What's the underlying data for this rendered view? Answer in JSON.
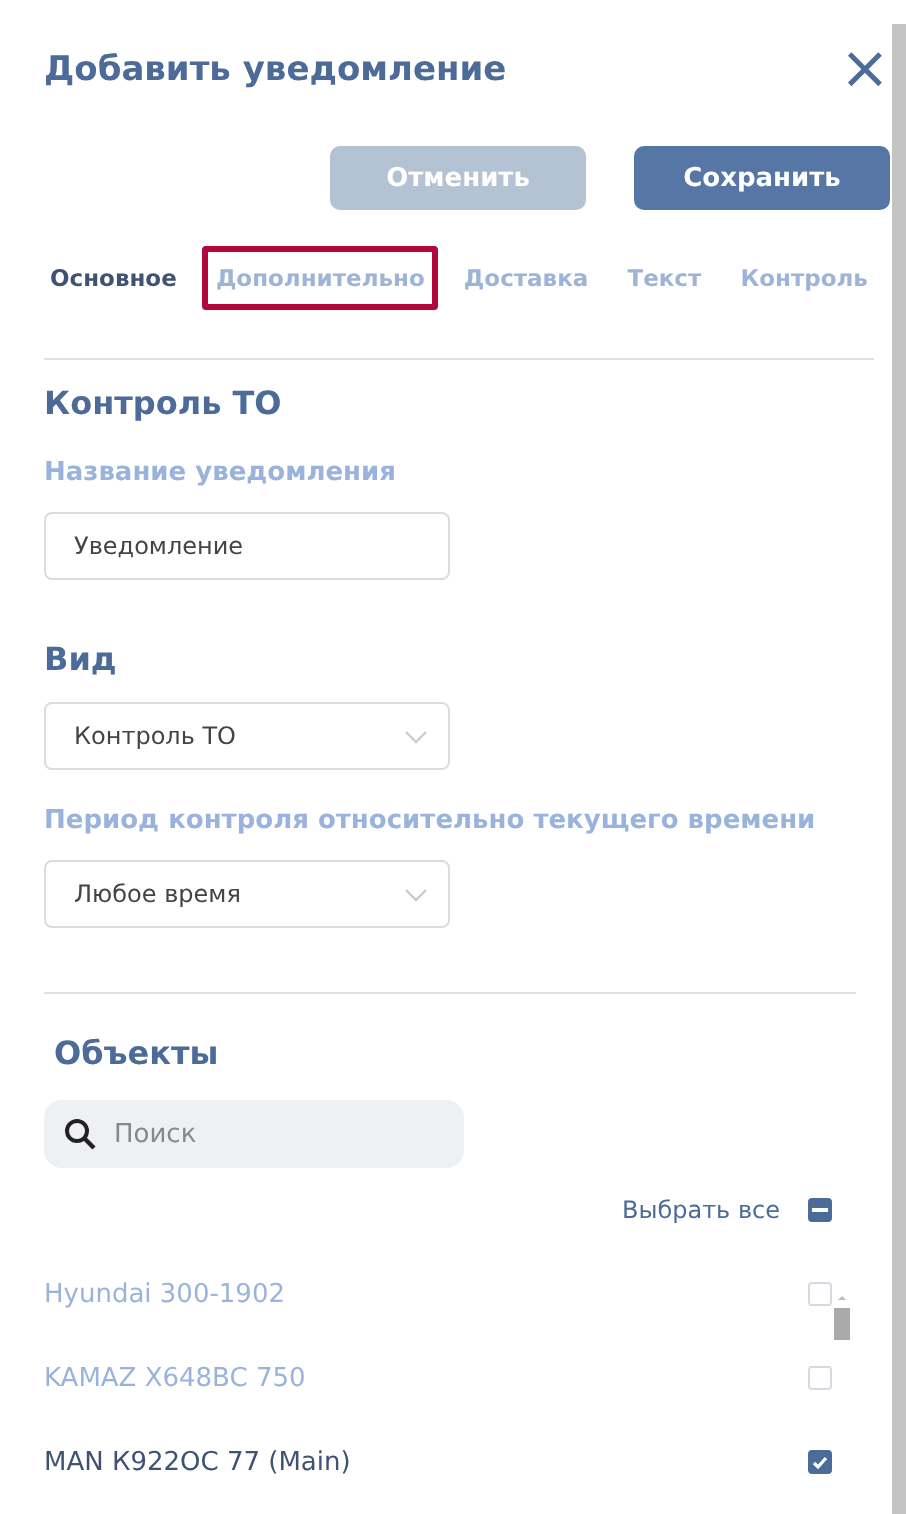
{
  "dialog": {
    "title": "Добавить уведомление",
    "close": "×"
  },
  "buttons": [
    {
      "label": "Отменить",
      "kind": "secondary",
      "disabled": true
    },
    {
      "label": "Сохранить",
      "kind": "primary",
      "disabled": false
    }
  ],
  "tabs": [
    {
      "label": "Основное",
      "selected": true,
      "highlighted": false
    },
    {
      "label": "Дополнительно",
      "selected": false,
      "highlighted": true
    },
    {
      "label": "Доставка",
      "selected": false,
      "highlighted": false
    },
    {
      "label": "Текст",
      "selected": false,
      "highlighted": false
    },
    {
      "label": "Контроль",
      "selected": false,
      "highlighted": false
    }
  ],
  "section_title": "Контроль ТО",
  "name_label": "Название уведомления",
  "name_value": "Уведомление",
  "type_title": "Вид",
  "type_value": "Контроль ТО",
  "period_label": "Период контроля относительно текущего времени",
  "period_value": "Любое время",
  "objects": {
    "title": "Объекты",
    "search_placeholder": "Поиск",
    "select_all": {
      "label": "Выбрать все",
      "indeterminate": true
    },
    "items": [
      {
        "name": "Hyundai 300-1902",
        "checked": false
      },
      {
        "name": "KAMAZ X648BC 750",
        "checked": false
      },
      {
        "name": "MAN К922ОС 77 (Main)",
        "checked": true
      }
    ]
  }
}
